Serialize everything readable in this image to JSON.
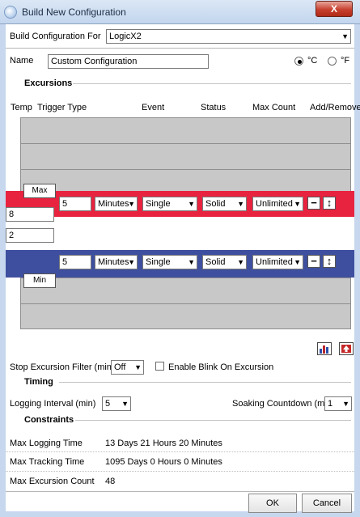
{
  "window": {
    "title": "Build New Configuration",
    "close_label": "X"
  },
  "build_for": {
    "label": "Build Configuration For",
    "value": "LogicX2"
  },
  "name": {
    "label": "Name",
    "value": "Custom Configuration"
  },
  "units": {
    "celsius": "°C",
    "fahrenheit": "°F",
    "selected": "celsius"
  },
  "excursions": {
    "section_label": "Excursions",
    "headers": {
      "temp": "Temp",
      "trigger_type": "Trigger Type",
      "event": "Event",
      "status": "Status",
      "max_count": "Max Count",
      "add_remove": "Add/Remove"
    },
    "max": {
      "tag": "Max",
      "temp": "8",
      "trigger_value": "5",
      "trigger_unit": "Minutes",
      "event": "Single",
      "status": "Solid",
      "max_count": "Unlimited",
      "row_color": "#e8233f"
    },
    "min": {
      "tag": "Min",
      "temp": "2",
      "trigger_value": "5",
      "trigger_unit": "Minutes",
      "event": "Single",
      "status": "Solid",
      "max_count": "Unlimited",
      "row_color": "#3f4f9f"
    },
    "remove_glyph": "−",
    "move_glyph": "↕"
  },
  "options": {
    "stop_filter_label": "Stop Excursion Filter (min)",
    "stop_filter_value": "Off",
    "enable_blink_label": "Enable Blink On Excursion",
    "enable_blink_checked": false
  },
  "timing": {
    "section_label": "Timing",
    "logging_label": "Logging Interval (min)",
    "logging_value": "5",
    "soaking_label": "Soaking Countdown (min)",
    "soaking_value": "1"
  },
  "constraints": {
    "section_label": "Constraints",
    "max_logging_label": "Max Logging Time",
    "max_logging_value": "13 Days 21 Hours 20 Minutes",
    "max_tracking_label": "Max Tracking Time",
    "max_tracking_value": "1095 Days 0 Hours 0 Minutes",
    "max_excursion_label": "Max Excursion Count",
    "max_excursion_value": "48"
  },
  "buttons": {
    "ok": "OK",
    "cancel": "Cancel"
  }
}
